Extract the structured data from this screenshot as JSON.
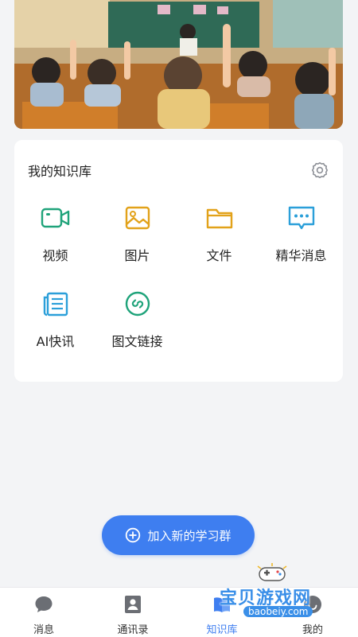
{
  "knowledge_base": {
    "title": "我的知识库",
    "items": [
      {
        "label": "视频",
        "icon": "video-icon"
      },
      {
        "label": "图片",
        "icon": "image-icon"
      },
      {
        "label": "文件",
        "icon": "folder-icon"
      },
      {
        "label": "精华消息",
        "icon": "chat-bubble-icon"
      },
      {
        "label": "AI快讯",
        "icon": "news-icon"
      },
      {
        "label": "图文链接",
        "icon": "link-icon"
      }
    ]
  },
  "join_button": {
    "label": "加入新的学习群",
    "icon": "plus-circle-icon"
  },
  "tabbar": {
    "active": 2,
    "tabs": [
      {
        "label": "消息",
        "icon": "message-icon"
      },
      {
        "label": "通讯录",
        "icon": "contacts-icon"
      },
      {
        "label": "知识库",
        "icon": "book-icon"
      },
      {
        "label": "我的",
        "icon": "profile-icon"
      }
    ]
  },
  "watermark": {
    "name": "宝贝游戏网",
    "url": "baobeiy.com"
  },
  "colors": {
    "accent": "#3e7ef0",
    "video": "#1fa37a",
    "image": "#e2a21a",
    "folder": "#e2a21a",
    "chat": "#2b9fd9",
    "news": "#2b9fd9",
    "link": "#1fa37a"
  }
}
